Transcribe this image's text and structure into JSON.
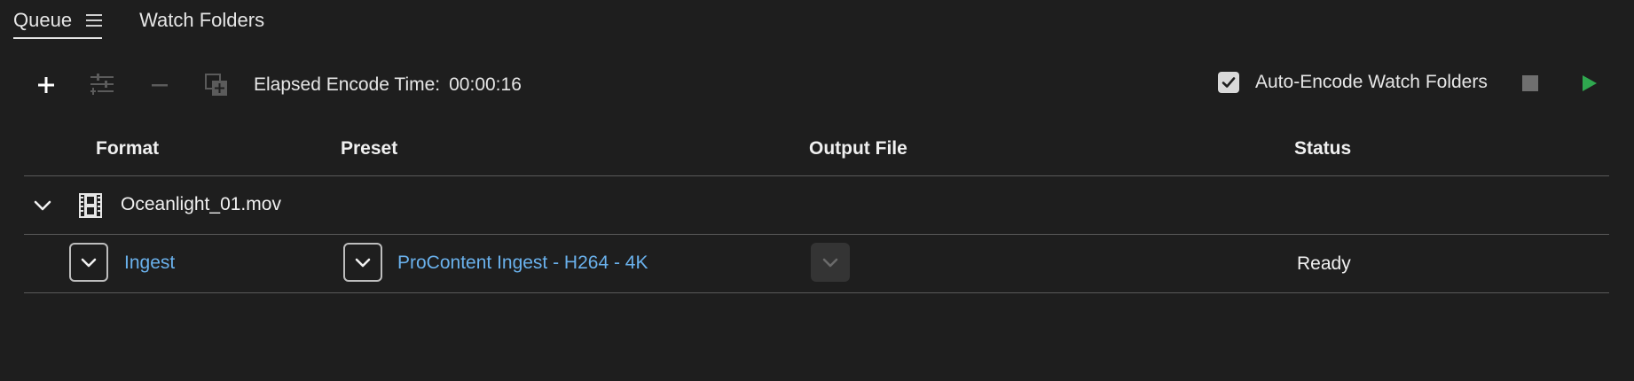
{
  "tabs": [
    {
      "label": "Queue",
      "active": true
    },
    {
      "label": "Watch Folders",
      "active": false
    }
  ],
  "toolbar": {
    "elapsed_label": "Elapsed Encode Time:",
    "elapsed_value": "00:00:16",
    "auto_encode_label": "Auto-Encode Watch Folders",
    "auto_encode_checked": true,
    "icons": [
      "add-icon",
      "settings-sliders-icon",
      "remove-icon",
      "duplicate-icon",
      "stop-icon",
      "play-icon"
    ]
  },
  "table": {
    "headers": {
      "format": "Format",
      "preset": "Preset",
      "output_file": "Output File",
      "status": "Status"
    },
    "source": {
      "name": "Oceanlight_01.mov",
      "expanded": true
    },
    "outputs": [
      {
        "format": "Ingest",
        "preset": "ProContent Ingest - H264 - 4K",
        "output_file": "",
        "status": "Ready"
      }
    ]
  },
  "colors": {
    "background": "#1e1e1e",
    "link": "#6ab1ec",
    "play": "#2fa84f",
    "divider": "#5a5a5a"
  }
}
